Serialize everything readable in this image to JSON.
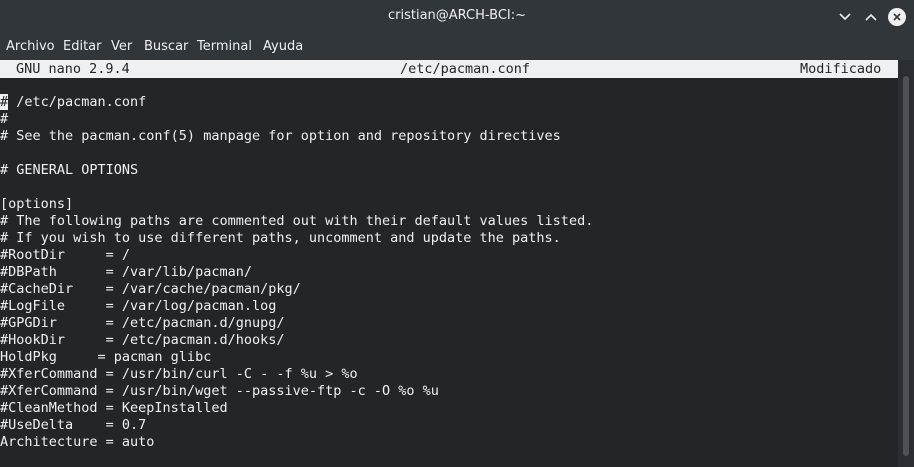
{
  "window": {
    "title": "cristian@ARCH-BCI:~"
  },
  "menu": [
    "Archivo",
    "Editar",
    "Ver",
    "Buscar",
    "Terminal",
    "Ayuda"
  ],
  "nano": {
    "version": "GNU nano 2.9.4",
    "filename": "/etc/pacman.conf",
    "state": "Modificado"
  },
  "file_lines": [
    "# /etc/pacman.conf",
    "#",
    "# See the pacman.conf(5) manpage for option and repository directives",
    "",
    "# GENERAL OPTIONS",
    "",
    "[options]",
    "# The following paths are commented out with their default values listed.",
    "# If you wish to use different paths, uncomment and update the paths.",
    "#RootDir     = /",
    "#DBPath      = /var/lib/pacman/",
    "#CacheDir    = /var/cache/pacman/pkg/",
    "#LogFile     = /var/log/pacman.log",
    "#GPGDir      = /etc/pacman.d/gnupg/",
    "#HookDir     = /etc/pacman.d/hooks/",
    "HoldPkg     = pacman glibc",
    "#XferCommand = /usr/bin/curl -C - -f %u > %o",
    "#XferCommand = /usr/bin/wget --passive-ftp -c -O %o %u",
    "#CleanMethod = KeepInstalled",
    "#UseDelta    = 0.7",
    "Architecture = auto"
  ],
  "icons": {
    "minimize": "chevron-down-icon",
    "maximize": "chevron-up-icon",
    "close": "close-icon"
  }
}
